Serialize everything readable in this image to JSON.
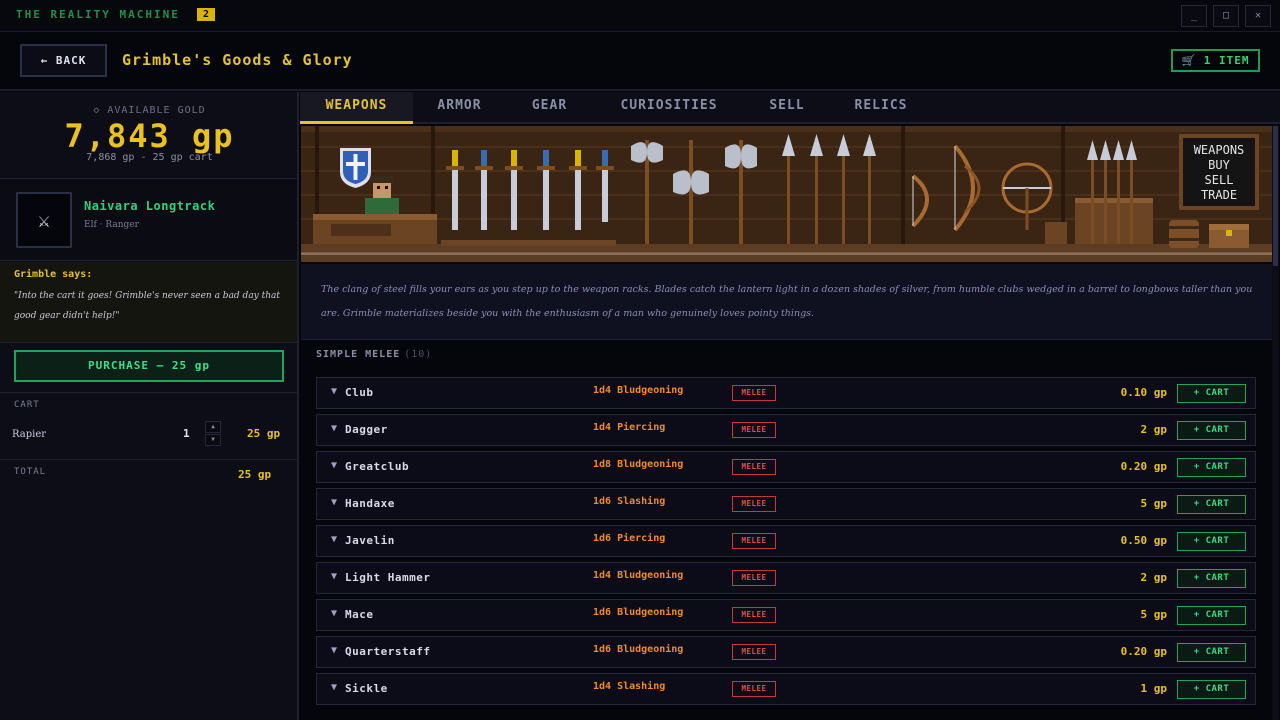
{
  "app": {
    "title": "THE REALITY MACHINE",
    "badge": "2",
    "window_controls": {
      "minimize": "_",
      "maximize": "□",
      "close": "✕"
    }
  },
  "header": {
    "back_label": "← BACK",
    "shop_title": "Grimble's Goods & Glory",
    "cart_summary": "🛒 1 ITEM"
  },
  "sidebar": {
    "gold_label": "◇ AVAILABLE GOLD",
    "gold_amount": "7,843 gp",
    "gold_sub": "7,868 gp - 25 gp cart",
    "character": {
      "avatar_glyph": "⚔",
      "name": "Naivara Longtrack",
      "class": "Elf · Ranger"
    },
    "merchant": {
      "label": "Grimble says:",
      "quote": "\"Into the cart it goes! Grimble's never seen a bad day that good gear didn't help!\""
    },
    "purchase_label": "PURCHASE — 25 gp",
    "cart": {
      "label": "CART",
      "items": [
        {
          "name": "Rapier",
          "qty": "1",
          "price": "25 gp"
        }
      ],
      "stepper_up": "▲",
      "stepper_down": "▼"
    },
    "total_label": "TOTAL",
    "total_value": "25 gp"
  },
  "tabs": [
    {
      "label": "WEAPONS",
      "active": true
    },
    {
      "label": "ARMOR",
      "active": false
    },
    {
      "label": "GEAR",
      "active": false
    },
    {
      "label": "CURIOSITIES",
      "active": false
    },
    {
      "label": "SELL",
      "active": false
    },
    {
      "label": "RELICS",
      "active": false
    }
  ],
  "banner": {
    "sign_lines": [
      "WEAPONS",
      "BUY",
      "SELL",
      "TRADE"
    ]
  },
  "description": "The clang of steel fills your ears as you step up to the weapon racks. Blades catch the lantern light in a dozen shades of silver, from humble clubs wedged in a barrel to longbows taller than you are. Grimble materializes beside you with the enthusiasm of a man who genuinely loves pointy things.",
  "section": {
    "title": "SIMPLE MELEE",
    "count": "(10)"
  },
  "items": [
    {
      "name": "Club",
      "damage": "1d4 Bludgeoning",
      "tag": "MELEE",
      "price": "0.10 gp",
      "cart_label": "+ CART"
    },
    {
      "name": "Dagger",
      "damage": "1d4 Piercing",
      "tag": "MELEE",
      "price": "2 gp",
      "cart_label": "+ CART"
    },
    {
      "name": "Greatclub",
      "damage": "1d8 Bludgeoning",
      "tag": "MELEE",
      "price": "0.20 gp",
      "cart_label": "+ CART"
    },
    {
      "name": "Handaxe",
      "damage": "1d6 Slashing",
      "tag": "MELEE",
      "price": "5 gp",
      "cart_label": "+ CART"
    },
    {
      "name": "Javelin",
      "damage": "1d6 Piercing",
      "tag": "MELEE",
      "price": "0.50 gp",
      "cart_label": "+ CART"
    },
    {
      "name": "Light Hammer",
      "damage": "1d4 Bludgeoning",
      "tag": "MELEE",
      "price": "2 gp",
      "cart_label": "+ CART"
    },
    {
      "name": "Mace",
      "damage": "1d6 Bludgeoning",
      "tag": "MELEE",
      "price": "5 gp",
      "cart_label": "+ CART"
    },
    {
      "name": "Quarterstaff",
      "damage": "1d6 Bludgeoning",
      "tag": "MELEE",
      "price": "0.20 gp",
      "cart_label": "+ CART"
    },
    {
      "name": "Sickle",
      "damage": "1d4 Slashing",
      "tag": "MELEE",
      "price": "1 gp",
      "cart_label": "+ CART"
    }
  ],
  "colors": {
    "accent_gold": "#e3c234",
    "accent_green": "#2fd27a",
    "damage_orange": "#f08a2a",
    "melee_red": "#e24b4b",
    "background": "#05060b"
  }
}
